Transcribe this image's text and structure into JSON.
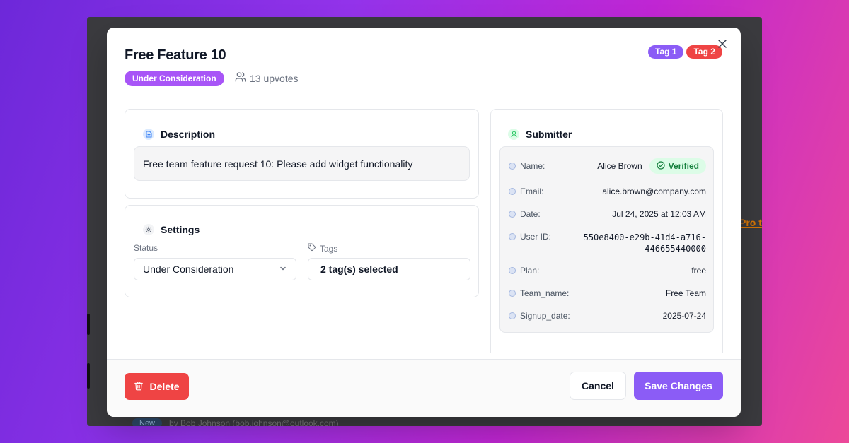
{
  "background_app": {
    "link_text": "Pro t",
    "row_badge": "New",
    "row_text": "by Bob Johnson (bob.johnson@outlook.com)"
  },
  "modal": {
    "title": "Free Feature 10",
    "status_badge": "Under Consideration",
    "upvotes": "13 upvotes",
    "tags": [
      {
        "label": "Tag 1",
        "color": "#8b5cf6"
      },
      {
        "label": "Tag 2",
        "color": "#ef4444"
      }
    ],
    "close_icon": "x-icon"
  },
  "description": {
    "heading": "Description",
    "text": "Free team feature request 10: Please add widget functionality"
  },
  "settings": {
    "heading": "Settings",
    "status_label": "Status",
    "status_value": "Under Consideration",
    "tags_label": "Tags",
    "tags_value": "2 tag(s) selected"
  },
  "submitter": {
    "heading": "Submitter",
    "rows": [
      {
        "key": "Name:",
        "value": "Alice Brown",
        "badge": "Verified"
      },
      {
        "key": "Email:",
        "value": "alice.brown@company.com"
      },
      {
        "key": "Date:",
        "value": "Jul 24, 2025 at 12:03 AM"
      },
      {
        "key": "User ID:",
        "value_line1": "550e8400-e29b-41d4-a716-",
        "value_line2": "446655440000"
      },
      {
        "key": "Plan:",
        "value": "free"
      },
      {
        "key": "Team_name:",
        "value": "Free Team"
      },
      {
        "key": "Signup_date:",
        "value": "2025-07-24"
      }
    ]
  },
  "footer": {
    "delete_label": "Delete",
    "cancel_label": "Cancel",
    "save_label": "Save Changes"
  },
  "colors": {
    "accent": "#8b5cf6",
    "status_purple": "#a855f7",
    "danger": "#ef4444",
    "verified_bg": "#dcfce7",
    "verified_text": "#15803d"
  }
}
